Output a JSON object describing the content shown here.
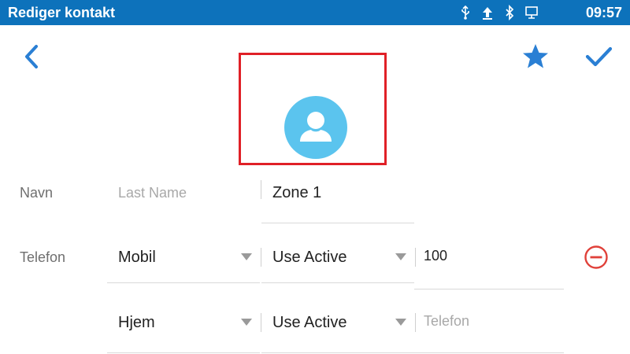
{
  "statusbar": {
    "title": "Rediger kontakt",
    "time": "09:57",
    "icons": [
      "usb-icon",
      "upload-icon",
      "bluetooth-icon",
      "network-icon"
    ]
  },
  "toolbar": {
    "back_icon": "chevron-left-icon",
    "favorite_icon": "star-icon",
    "save_icon": "checkmark-icon"
  },
  "photo": {
    "icon": "person-avatar-icon",
    "avatar_color": "#5bc4ee",
    "frame_color": "#e02027"
  },
  "name_row": {
    "label": "Navn",
    "last_name": {
      "value": "",
      "placeholder": "Last Name"
    },
    "first_name": {
      "value": "Zone 1",
      "placeholder": ""
    }
  },
  "phone_row_1": {
    "label": "Telefon",
    "type": "Mobil",
    "account": "Use Active",
    "number": {
      "value": "100",
      "placeholder": ""
    },
    "remove_icon": "minus-circle-icon"
  },
  "phone_row_2": {
    "type": "Hjem",
    "account": "Use Active",
    "number": {
      "value": "",
      "placeholder": "Telefon"
    }
  },
  "colors": {
    "statusbar": "#0d72bb",
    "accent": "#2a7fd4",
    "remove": "#e0413a"
  }
}
